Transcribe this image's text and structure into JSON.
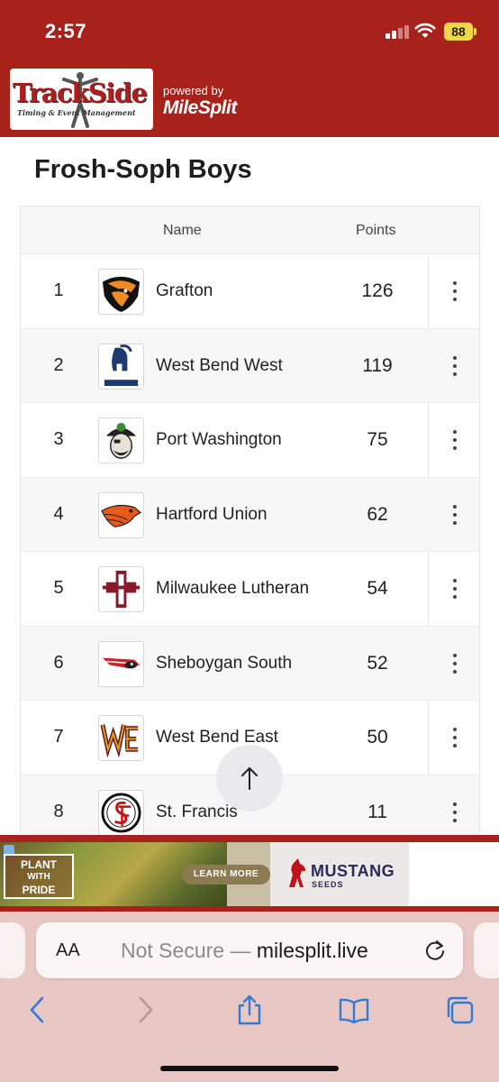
{
  "status_bar": {
    "time": "2:57",
    "battery": "88"
  },
  "header": {
    "logo_text": "TrackSide",
    "logo_subtext": "Timing & Event Management",
    "powered_by": "powered by",
    "brand": "MileSplit"
  },
  "page": {
    "title": "Frosh-Soph Boys"
  },
  "table": {
    "columns": {
      "name": "Name",
      "points": "Points"
    },
    "rows": [
      {
        "rank": "1",
        "team": "Grafton",
        "points": "126",
        "logo_icon": "grafton-hawk-logo"
      },
      {
        "rank": "2",
        "team": "West Bend West",
        "points": "119",
        "logo_icon": "spartans-helmet-logo"
      },
      {
        "rank": "3",
        "team": "Port Washington",
        "points": "75",
        "logo_icon": "pirate-logo"
      },
      {
        "rank": "4",
        "team": "Hartford Union",
        "points": "62",
        "logo_icon": "orange-hawk-logo"
      },
      {
        "rank": "5",
        "team": "Milwaukee Lutheran",
        "points": "54",
        "logo_icon": "cross-crest-logo"
      },
      {
        "rank": "6",
        "team": "Sheboygan South",
        "points": "52",
        "logo_icon": "redwing-logo"
      },
      {
        "rank": "7",
        "team": "West Bend East",
        "points": "50",
        "logo_icon": "wbe-letters-logo"
      },
      {
        "rank": "8",
        "team": "St. Francis",
        "points": "11",
        "logo_icon": "sf-monogram-logo"
      }
    ]
  },
  "ad": {
    "plant_line1": "PLANT",
    "plant_line2": "WITH",
    "plant_line3": "PRIDE",
    "cta": "LEARN MORE",
    "brand": "MUSTANG",
    "brand_sub": "SEEDS"
  },
  "browser": {
    "aa_label": "AA",
    "url_prefix": "Not Secure — ",
    "url_domain": "milesplit.live"
  },
  "colors": {
    "brand_red": "#a6221b",
    "battery": "#f0d74a",
    "ios_blue": "#2f7bd6"
  }
}
